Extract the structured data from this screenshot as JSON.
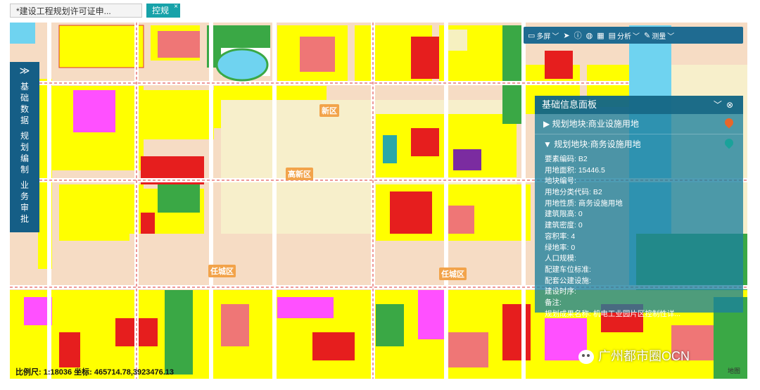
{
  "tabs": [
    {
      "label": "*建设工程规划许可证申..."
    },
    {
      "label": "控规",
      "close": "×"
    }
  ],
  "sidebar": {
    "toggle_icon": "≫",
    "group1": "基础数据",
    "group2": "规划编制",
    "group3": "业务审批"
  },
  "toolbar": {
    "items": [
      {
        "icon": "rect-icon",
        "glyph": "▭",
        "label": "多屏",
        "dropdown": "﹀"
      },
      {
        "icon": "pointer-icon",
        "glyph": "➤",
        "label": ""
      },
      {
        "icon": "info-icon",
        "glyph": "ⓘ",
        "label": ""
      },
      {
        "icon": "globe-icon",
        "glyph": "◍",
        "label": ""
      },
      {
        "icon": "calculator-icon",
        "glyph": "▦",
        "label": ""
      },
      {
        "icon": "analysis-icon",
        "glyph": "▤",
        "label": "分析",
        "dropdown": "﹀"
      },
      {
        "icon": "ruler-icon",
        "glyph": "✎",
        "label": "测量",
        "dropdown": "﹀"
      }
    ]
  },
  "map": {
    "district_labels": [
      "高新区",
      "任城区",
      "任城区",
      "新区"
    ]
  },
  "panel": {
    "title": "基础信息面板",
    "collapse_icon": "﹀",
    "close_icon": "⊗",
    "sections": [
      {
        "arrow": "▶",
        "title": "规划地块:商业设施用地",
        "pin_color": "#e8672a"
      },
      {
        "arrow": "▼",
        "title": "规划地块:商务设施用地",
        "pin_color": "#1aa29a"
      }
    ],
    "attributes": [
      "要素编码: B2",
      "用地面积: 15446.5",
      "地块编号:",
      "用地分类代码: B2",
      "用地性质: 商务设施用地",
      "建筑限高: 0",
      "建筑密度: 0",
      "容积率: 4",
      "绿地率: 0",
      "人口规模:",
      "配建车位标准:",
      "配套公建设施:",
      "建设时序:",
      "备注:",
      "规划成果名称: 机电工业园片区控制性详..."
    ]
  },
  "status": {
    "scale": "比例尺: 1:18036",
    "coords": "坐标: 465714.78,3923476.13"
  },
  "watermark": "广州都市圈OCN",
  "map_link": "地图"
}
